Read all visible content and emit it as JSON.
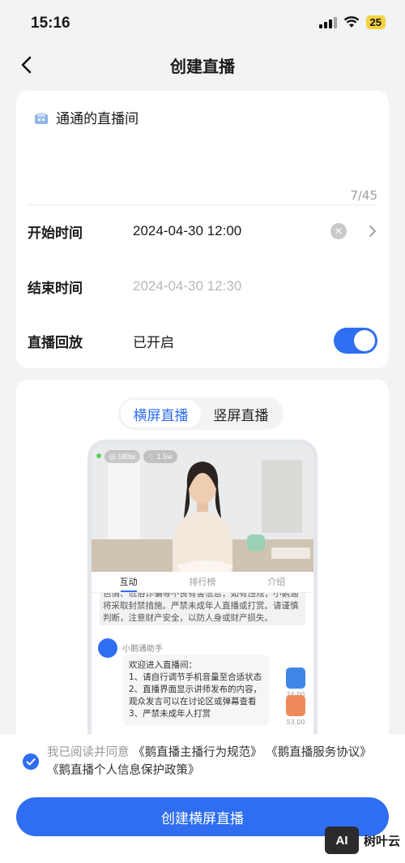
{
  "status": {
    "time": "15:16",
    "battery": "25"
  },
  "nav": {
    "title": "创建直播"
  },
  "form": {
    "title_value": "通通的直播间",
    "title_counter": "7/45",
    "start_label": "开始时间",
    "start_value": "2024-04-30 12:00",
    "end_label": "结束时间",
    "end_value": "2024-04-30 12:30",
    "replay_label": "直播回放",
    "replay_value": "已开启",
    "replay_on": true
  },
  "orientation": {
    "tabs": [
      "横屏直播",
      "竖屏直播"
    ],
    "selected": "横屏直播"
  },
  "preview": {
    "viewers": "180w",
    "likes": "1.5w",
    "tabs": [
      "互动",
      "排行榜",
      "介绍"
    ],
    "notice_lines": [
      "色情、低俗诈骗等不良有害信息，如有违规，小鹅通",
      "将采取封禁措施。严禁未成年人直播或打赏。请谨慎",
      "判断，注意财产安全，以防人身或财产损失。"
    ],
    "assistant_name": "小鹅通助手",
    "welcome_lines": [
      "欢迎进入直播间：",
      "1、请自行调节手机音量至合适状态",
      "2、直播界面显示讲师发布的内容，",
      "观众发言可以在讨论区或弹幕查看",
      "3、严禁未成年人打赏"
    ],
    "side_labels": [
      "24:00",
      "53.00"
    ]
  },
  "agreement": {
    "prefix": "我已阅读并同意",
    "links": [
      "《鹅直播主播行为规范》",
      "《鹅直播服务协议》",
      "《鹅直播个人信息保护政策》"
    ],
    "checked": true
  },
  "create_button": "创建横屏直播",
  "watermark": {
    "logo": "AI",
    "text": "树叶云"
  },
  "colors": {
    "accent": "#2f6ef0",
    "background": "#f2f3f5"
  }
}
